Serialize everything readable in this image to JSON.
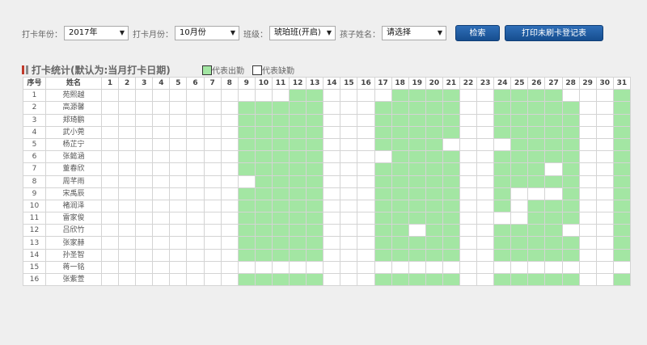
{
  "filters": {
    "year_label": "打卡年份：",
    "year_value": "2017年",
    "month_label": "打卡月份：",
    "month_value": "10月份",
    "class_label": "班级：",
    "class_value": "琥珀班(开启)",
    "child_label": "孩子姓名：",
    "child_value": "请选择",
    "search_button": "检索",
    "print_button": "打印未刷卡登记表"
  },
  "title": "打卡统计(默认为:当月打卡日期)",
  "legend": {
    "present_label": "代表出勤",
    "absent_label": "代表缺勤",
    "present_color": "#a3e6a3",
    "absent_color": "#ffffff"
  },
  "table": {
    "col_index": "序号",
    "col_name": "姓名",
    "days": [
      "1",
      "2",
      "3",
      "4",
      "5",
      "6",
      "7",
      "8",
      "9",
      "10",
      "11",
      "12",
      "13",
      "14",
      "15",
      "16",
      "17",
      "18",
      "19",
      "20",
      "21",
      "22",
      "23",
      "24",
      "25",
      "26",
      "27",
      "28",
      "29",
      "30",
      "31"
    ],
    "rows": [
      {
        "no": "1",
        "name": "苑熙越",
        "att": "00000000000110000111100111100011"
      },
      {
        "no": "2",
        "name": "高源馨",
        "att": "00000000111110001111100111110011"
      },
      {
        "no": "3",
        "name": "郑琦鹏",
        "att": "00000000111110001111100111110011"
      },
      {
        "no": "4",
        "name": "武小莞",
        "att": "00000000111110001111100111110011"
      },
      {
        "no": "5",
        "name": "杨芷宁",
        "att": "00000000111110001111000011110011"
      },
      {
        "no": "6",
        "name": "张懿涵",
        "att": "00000000111110000111100111110011"
      },
      {
        "no": "7",
        "name": "董春欣",
        "att": "00000000111110001111100111010010"
      },
      {
        "no": "8",
        "name": "周芊雨",
        "att": "00000000011110001111100111110011"
      },
      {
        "no": "9",
        "name": "宋禹辰",
        "att": "00000000111110001111100100010011"
      },
      {
        "no": "10",
        "name": "褚润泽",
        "att": "00000000111110001111100101110011"
      },
      {
        "no": "11",
        "name": "雷家俊",
        "att": "00000000111110001111100001110011"
      },
      {
        "no": "12",
        "name": "吕欣竹",
        "att": "00000000111110001101100111100011"
      },
      {
        "no": "13",
        "name": "张家赫",
        "att": "00000000111110001111100111110011"
      },
      {
        "no": "14",
        "name": "孙圣智",
        "att": "00000000111110001111100111110011"
      },
      {
        "no": "15",
        "name": "蒋一铭",
        "att": "00000000000000000000000000000000"
      },
      {
        "no": "16",
        "name": "张紫萱",
        "att": "00000000111110001111100111110011"
      }
    ]
  }
}
